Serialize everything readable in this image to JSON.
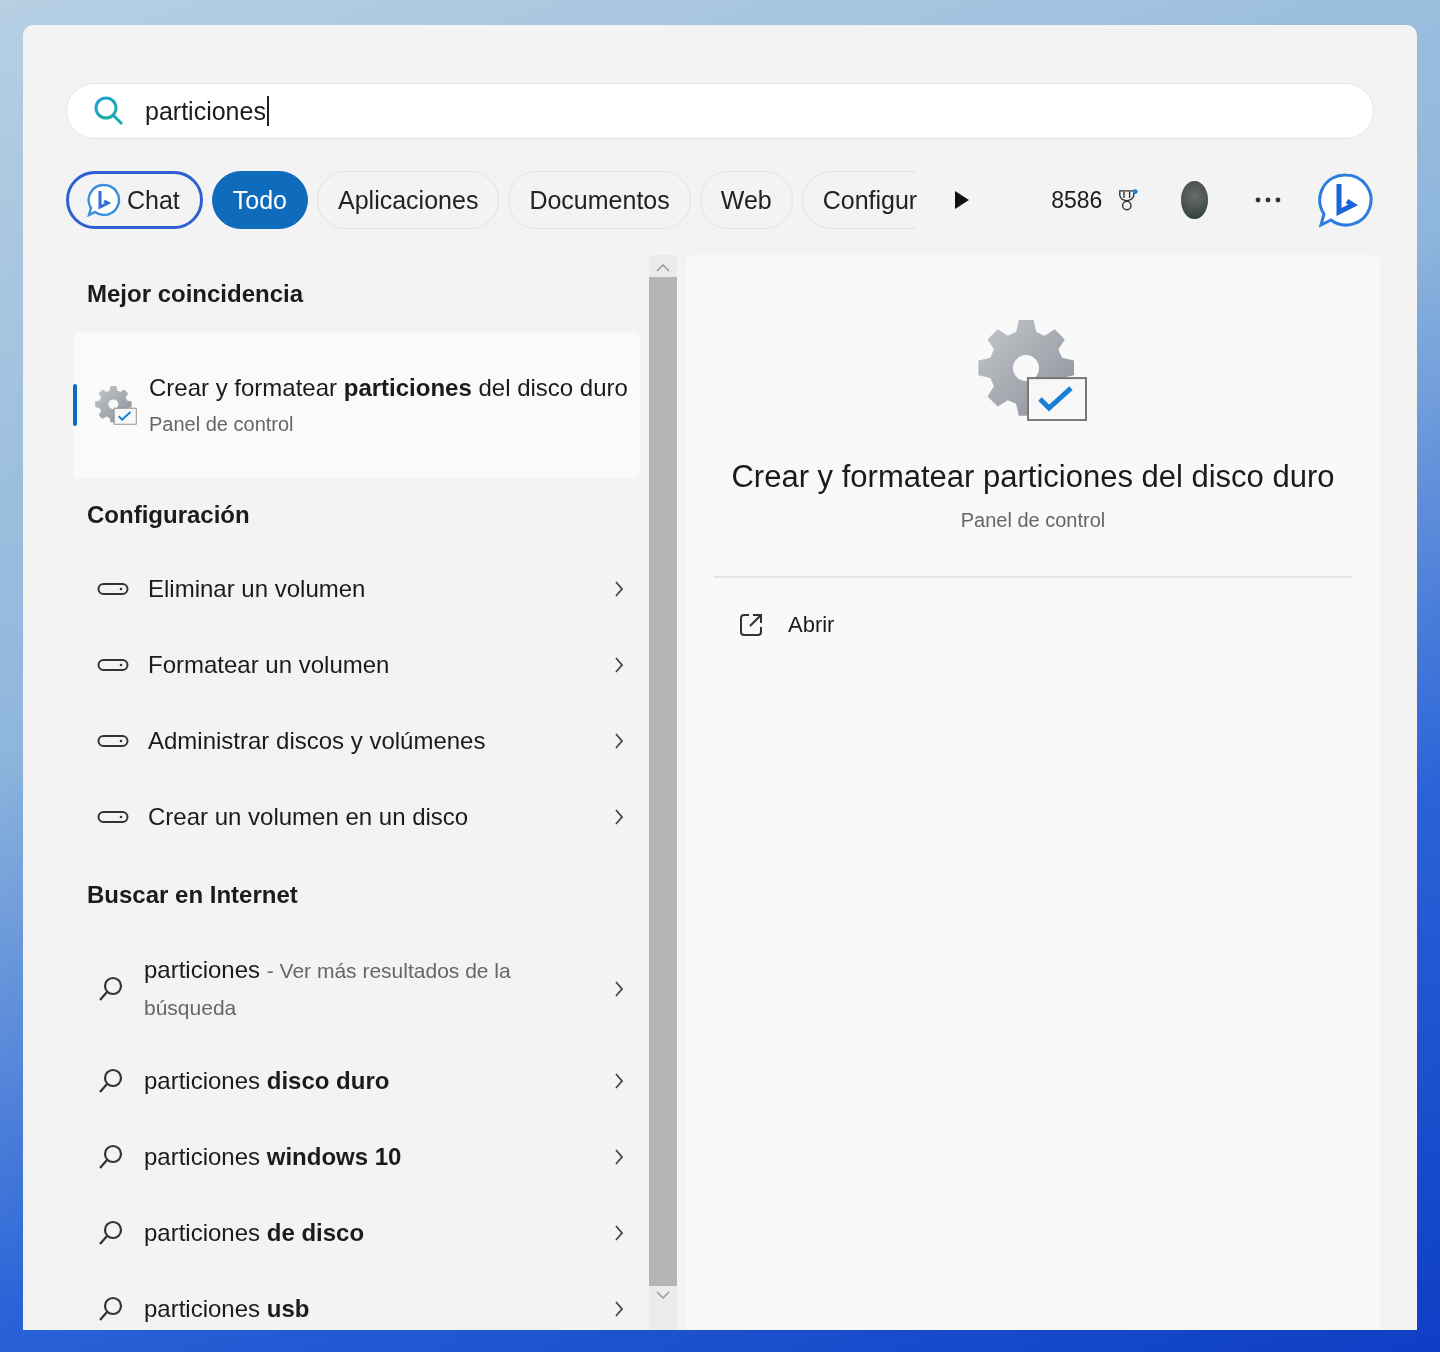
{
  "search": {
    "value": "particiones"
  },
  "filters": [
    {
      "label": "Chat",
      "kind": "chat",
      "selected": false
    },
    {
      "label": "Todo",
      "kind": "filter",
      "selected": true
    },
    {
      "label": "Aplicaciones",
      "kind": "filter",
      "selected": false
    },
    {
      "label": "Documentos",
      "kind": "filter",
      "selected": false
    },
    {
      "label": "Web",
      "kind": "filter",
      "selected": false
    },
    {
      "label": "Configur",
      "kind": "cut",
      "selected": false
    }
  ],
  "points": "8586",
  "best_match": {
    "heading": "Mejor coincidencia",
    "item": {
      "title": "Crear y formatear **particiones** del disco duro",
      "subtitle": "Panel de control",
      "selected": true
    }
  },
  "settings": {
    "heading": "Configuración",
    "items": [
      {
        "label": "Eliminar un volumen"
      },
      {
        "label": "Formatear un volumen"
      },
      {
        "label": "Administrar discos y volúmenes"
      },
      {
        "label": "Crear un volumen en un disco"
      }
    ]
  },
  "web": {
    "heading": "Buscar en Internet",
    "items": [
      {
        "text": "particiones",
        "hint": "- Ver más resultados de la búsqueda"
      },
      {
        "text": "particiones **disco duro**"
      },
      {
        "text": "particiones **windows 10**"
      },
      {
        "text": "particiones **de disco**"
      },
      {
        "text": "particiones **usb**"
      }
    ]
  },
  "detail": {
    "title": "Crear y formatear particiones del disco duro",
    "subtitle": "Panel de control",
    "actions": [
      {
        "label": "Abrir"
      }
    ]
  }
}
